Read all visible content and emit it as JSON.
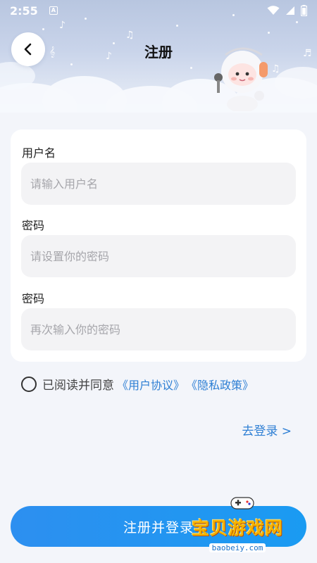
{
  "status_bar": {
    "time": "2:55",
    "notification_icon": "A",
    "icons": [
      "wifi-icon",
      "signal-icon",
      "battery-icon"
    ]
  },
  "header": {
    "title": "注册",
    "back_icon": "chevron-left-icon"
  },
  "form": {
    "username": {
      "label": "用户名",
      "placeholder": "请输入用户名",
      "value": ""
    },
    "password": {
      "label": "密码",
      "placeholder": "请设置你的密码",
      "value": ""
    },
    "confirm_password": {
      "label": "密码",
      "placeholder": "再次输入你的密码",
      "value": ""
    }
  },
  "agreement": {
    "text": "已阅读并同意",
    "user_agreement": "《用户协议》",
    "privacy_policy": "《隐私政策》",
    "checked": false
  },
  "goto_login": "去登录 >",
  "register_button": "注册并登录",
  "watermark": {
    "title": "宝贝游戏网",
    "url": "baobeiy.com"
  },
  "colors": {
    "accent": "#2e7fd4",
    "button": "#2d8ff0",
    "background": "#f3f5fa",
    "input_bg": "#f3f3f5"
  }
}
